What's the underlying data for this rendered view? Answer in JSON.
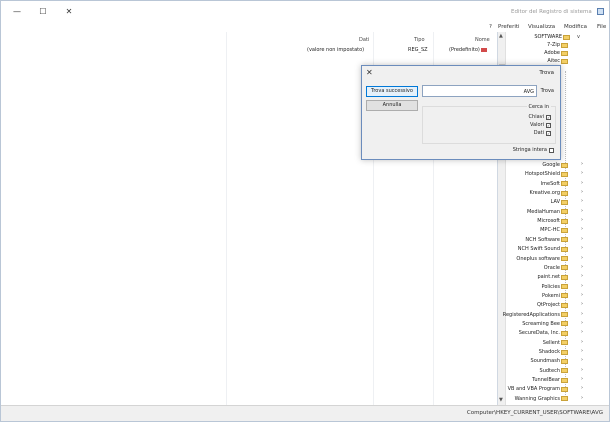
{
  "window": {
    "title": "Editor del Registro di sistema",
    "controls": {
      "minimize": "—",
      "maximize": "☐",
      "close": "✕"
    }
  },
  "menu": [
    "File",
    "Modifica",
    "Visualizza",
    "Preferiti",
    "?"
  ],
  "list": {
    "headers": {
      "name": "Nome",
      "type": "Tipo",
      "data": "Dati"
    },
    "rows": [
      {
        "name": "(Predefinito)",
        "type": "REG_SZ",
        "data": "(valore non impostato)"
      }
    ]
  },
  "tree": {
    "root": "SOFTWARE",
    "items_top": [
      "7-Zip",
      "Adobe",
      "Aitec"
    ],
    "items": [
      "Google",
      "HotspotShield",
      "ImeSoft",
      "Kreative.org",
      "LAV",
      "MediaHuman",
      "Microsoft",
      "MPC-HC",
      "NCH Software",
      "NCH Swift Sound",
      "Oneplus software",
      "Oracle",
      "paint.net",
      "Policies",
      "Pokemi",
      "QtProject",
      "RegisteredApplications",
      "Screaming Bee",
      "SecureData, Inc.",
      "Sellent",
      "Shadock",
      "Soundmash",
      "Sudtech",
      "TunnelBear",
      "VB and VBA Program",
      "Wanning Graphics"
    ]
  },
  "dialog": {
    "title": "Trova",
    "find_label": "Trova",
    "find_value": "AVG",
    "find_next": "Trova successivo",
    "cancel": "Annulla",
    "lookin_title": "Cerca in",
    "keys": "Chiavi",
    "values": "Valori",
    "data": "Dati",
    "match_whole": "Stringa intera"
  },
  "status": "Computer\\HKEY_CURRENT_USER\\SOFTWARE\\AVG"
}
